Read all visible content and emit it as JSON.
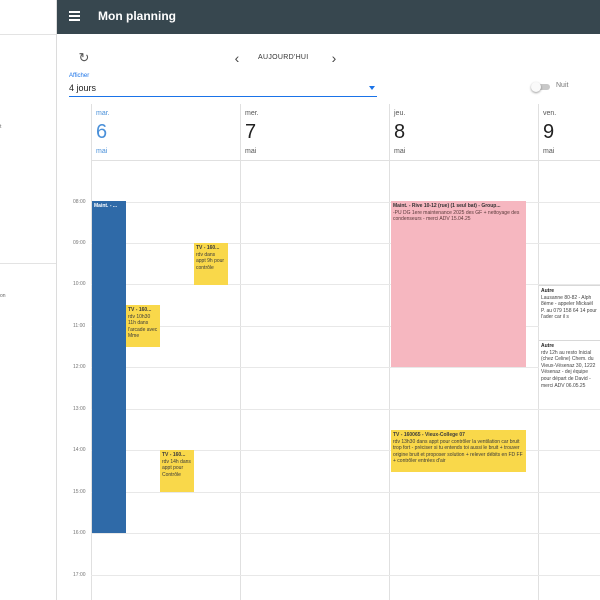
{
  "app": {
    "title": "Mon planning",
    "menu_icon": "hamburger-menu-icon"
  },
  "toolbar": {
    "refresh_icon": "refresh-icon",
    "prev_icon": "chevron-left-icon",
    "next_icon": "chevron-right-icon",
    "today_label": "AUJOURD'HUI",
    "afficher_label": "Afficher",
    "view_value": "4 jours",
    "night_label": "Nuit",
    "night_on": false
  },
  "drawer": {
    "fragments": [
      "t",
      "on"
    ]
  },
  "days": [
    {
      "dow": "mar.",
      "num": "6",
      "month": "mai",
      "today": true
    },
    {
      "dow": "mer.",
      "num": "7",
      "month": "mai",
      "today": false
    },
    {
      "dow": "jeu.",
      "num": "8",
      "month": "mai",
      "today": false
    },
    {
      "dow": "ven.",
      "num": "9",
      "month": "mai",
      "today": false
    }
  ],
  "hours": [
    "08:00",
    "09:00",
    "10:00",
    "11:00",
    "12:00",
    "13:00",
    "14:00",
    "15:00",
    "16:00",
    "17:00"
  ],
  "events": [
    {
      "title": "Maint. - ...",
      "text": "",
      "color": "blue"
    },
    {
      "title": "TV - 160...",
      "text": "rdv dans appt 9h pour contrôle",
      "color": "yellow"
    },
    {
      "title": "TV - 160...",
      "text": "rdv 10h30 11h dans l'arcade avec Mme",
      "color": "yellow"
    },
    {
      "title": "TV - 160...",
      "text": "rdv 14h dans appt pour Contrôle",
      "color": "yellow"
    },
    {
      "title": "Maint. - Rive 10-12 (rue) (1 seul bat) - Group...",
      "text": "-PU DG 1ere maintenance 2025 des GF + nettoyage des condenseurs - merci ADV 15.04.25",
      "color": "pink"
    },
    {
      "title": "TV - 160065 - Vieux-College 07",
      "text": "rdv 13h30 dans appt pour contrôler la ventilation car bruit trop fort - préciser si tu entends toi aussi le bruit + trouver origine bruit et proposer solution + relever débits en FD FF + contrôler entrées d'air",
      "color": "yellow"
    },
    {
      "title": "Autre",
      "text": "Lausanne 80-82 - Alph 8ème - appeler Mickaël P. au 079 158 64 14 pour l'ader car il s",
      "color": "grey"
    },
    {
      "title": "Autre",
      "text": "rdv 12h au resto Inicial (chez Celine) Chem. du Vieux-Vésenaz 30, 1222 Vésenaz - dej équipe pour départ de David - merci ADV 06.05.25",
      "color": "grey"
    }
  ]
}
